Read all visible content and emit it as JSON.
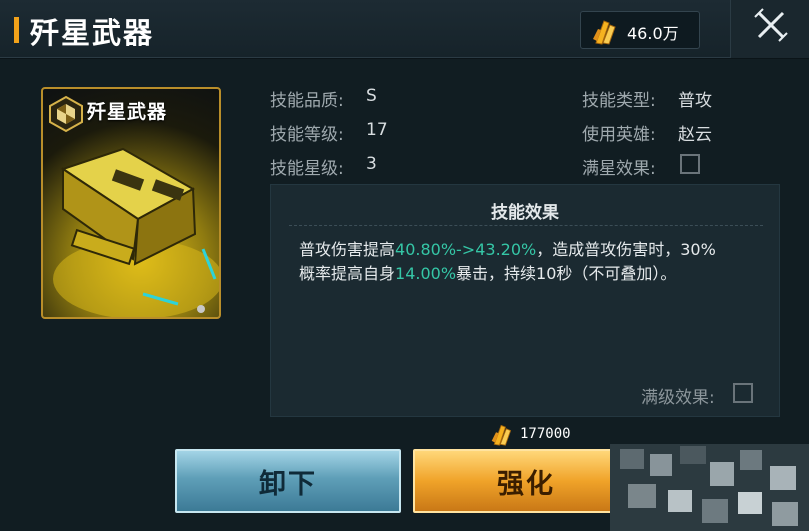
{
  "header": {
    "title": "歼星武器",
    "currency_amount": "46.0万",
    "currency_icon": "crystal-icon",
    "close_icon": "close-icon"
  },
  "card": {
    "title": "歼星武器",
    "badge_icon": "skill-badge-icon"
  },
  "info": {
    "quality_label": "技能品质:",
    "quality_value": "S",
    "level_label": "技能等级:",
    "level_value": "17",
    "star_label": "技能星级:",
    "star_value": "3",
    "type_label": "技能类型:",
    "type_value": "普攻",
    "hero_label": "使用英雄:",
    "hero_value": "赵云",
    "fullstar_label": "满星效果:"
  },
  "effect": {
    "title": "技能效果",
    "line1_a": "普攻伤害提高",
    "line1_hl": "40.80%->43.20%",
    "line1_b": "，造成普攻伤害时，30%",
    "line2_a": "概率提高自身",
    "line2_hl": "14.00%",
    "line2_b": "暴击，持续10秒（不可叠加）。",
    "maxlevel_label": "满级效果:"
  },
  "cost": {
    "amount": "177000",
    "icon": "crystal-icon"
  },
  "buttons": {
    "unequip": "卸下",
    "upgrade": "强化"
  },
  "colors": {
    "accent": "#f2a21a",
    "highlight": "#35c6a6",
    "card_border": "#b98e2a"
  }
}
